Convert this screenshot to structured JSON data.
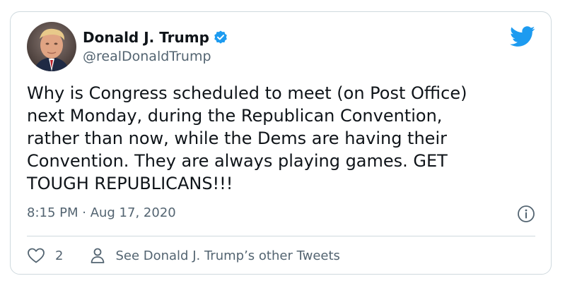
{
  "tweet": {
    "author_name": "Donald J. Trump",
    "handle": "@realDonaldTrump",
    "text_lines": [
      "Why is Congress scheduled to meet (on Post Office)",
      "next Monday, during the Republican Convention,",
      "rather than now, while the Dems are having their",
      "Convention. They are always playing games. GET",
      "TOUGH REPUBLICANS!!!"
    ],
    "timestamp": "8:15 PM · Aug 17, 2020",
    "like_count": "2",
    "profile_link_label": "See Donald J. Trump’s other Tweets"
  },
  "icons": {
    "verified": "verified-badge-icon",
    "brand": "twitter-bird-icon",
    "info": "info-icon",
    "like": "heart-icon",
    "profile": "person-icon"
  },
  "colors": {
    "accent": "#1d9bf0",
    "text_primary": "#0f1419",
    "text_secondary": "#536471",
    "border": "#cfd9de"
  }
}
